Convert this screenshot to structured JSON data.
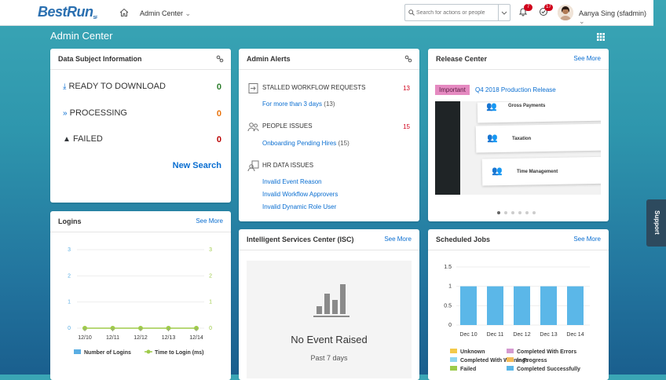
{
  "shell": {
    "logo": "BestRun",
    "logo_suffix": "SF",
    "nav_label": "Admin Center",
    "search_placeholder": "Search for actions or people",
    "notifications_count": "7",
    "tasks_count": "17",
    "user_name": "Aanya Sing (sfadmin)"
  },
  "page": {
    "title": "Admin Center"
  },
  "dsi": {
    "title": "Data Subject Information",
    "rows": [
      {
        "label": "READY TO DOWNLOAD",
        "value": "0",
        "color": "#2b7d2b"
      },
      {
        "label": "PROCESSING",
        "value": "0",
        "color": "#e9730c"
      },
      {
        "label": "FAILED",
        "value": "0",
        "color": "#bb0000"
      }
    ],
    "new_search": "New Search"
  },
  "alerts": {
    "title": "Admin Alerts",
    "groups": [
      {
        "title": "STALLED WORKFLOW REQUESTS",
        "count": "13",
        "links": [
          {
            "text": "For more than 3 days",
            "count": "(13)"
          }
        ]
      },
      {
        "title": "PEOPLE ISSUES",
        "count": "15",
        "links": [
          {
            "text": "Onboarding Pending Hires",
            "count": "(15)"
          }
        ]
      },
      {
        "title": "HR DATA ISSUES",
        "count": "",
        "links": [
          {
            "text": "Invalid Event Reason",
            "count": ""
          },
          {
            "text": "Invalid Workflow Approvers",
            "count": ""
          },
          {
            "text": "Invalid Dynamic Role User",
            "count": ""
          }
        ]
      }
    ]
  },
  "release": {
    "title": "Release Center",
    "see_more": "See More",
    "tag": "Important",
    "headline": "Q4 2018 Production Release",
    "slides": [
      "Gross Payments",
      "Taxation",
      "Time Management"
    ]
  },
  "logins": {
    "title": "Logins",
    "see_more": "See More"
  },
  "isc": {
    "title": "Intelligent Services Center (ISC)",
    "see_more": "See More",
    "empty_title": "No Event Raised",
    "empty_sub": "Past 7 days"
  },
  "jobs": {
    "title": "Scheduled Jobs",
    "see_more": "See More"
  },
  "support": {
    "label": "Support"
  },
  "chart_data": [
    {
      "type": "line",
      "title": "",
      "categories": [
        "12/10",
        "12/11",
        "12/12",
        "12/13",
        "12/14"
      ],
      "ylim": [
        0,
        3
      ],
      "yticks": [
        "0",
        "1",
        "2",
        "3"
      ],
      "series": [
        {
          "name": "Number of Logins",
          "values": [
            0,
            0,
            0,
            0,
            0
          ],
          "color": "#5aaee3"
        },
        {
          "name": "Time to Login (ms)",
          "values": [
            0,
            0,
            0,
            0,
            0
          ],
          "color": "#9fcb4a"
        }
      ]
    },
    {
      "type": "bar",
      "title": "",
      "categories": [
        "Dec 10",
        "Dec 11",
        "Dec 12",
        "Dec 13",
        "Dec 14"
      ],
      "ylim": [
        0,
        1.5
      ],
      "yticks": [
        "0",
        "0.5",
        "1",
        "1.5"
      ],
      "series": [
        {
          "name": "Completed Successfully",
          "values": [
            1,
            1,
            1,
            1,
            1
          ],
          "color": "#5bb7e8"
        }
      ],
      "legend": [
        {
          "name": "Unknown",
          "color": "#f3c94a"
        },
        {
          "name": "Completed With Errors",
          "color": "#d59ad0"
        },
        {
          "name": "Completed With Warnings",
          "color": "#8fd6ef"
        },
        {
          "name": "In Progress",
          "color": "#f3bb5a"
        },
        {
          "name": "Failed",
          "color": "#9bcb4a"
        },
        {
          "name": "Completed Successfully",
          "color": "#5bb7e8"
        }
      ]
    }
  ]
}
